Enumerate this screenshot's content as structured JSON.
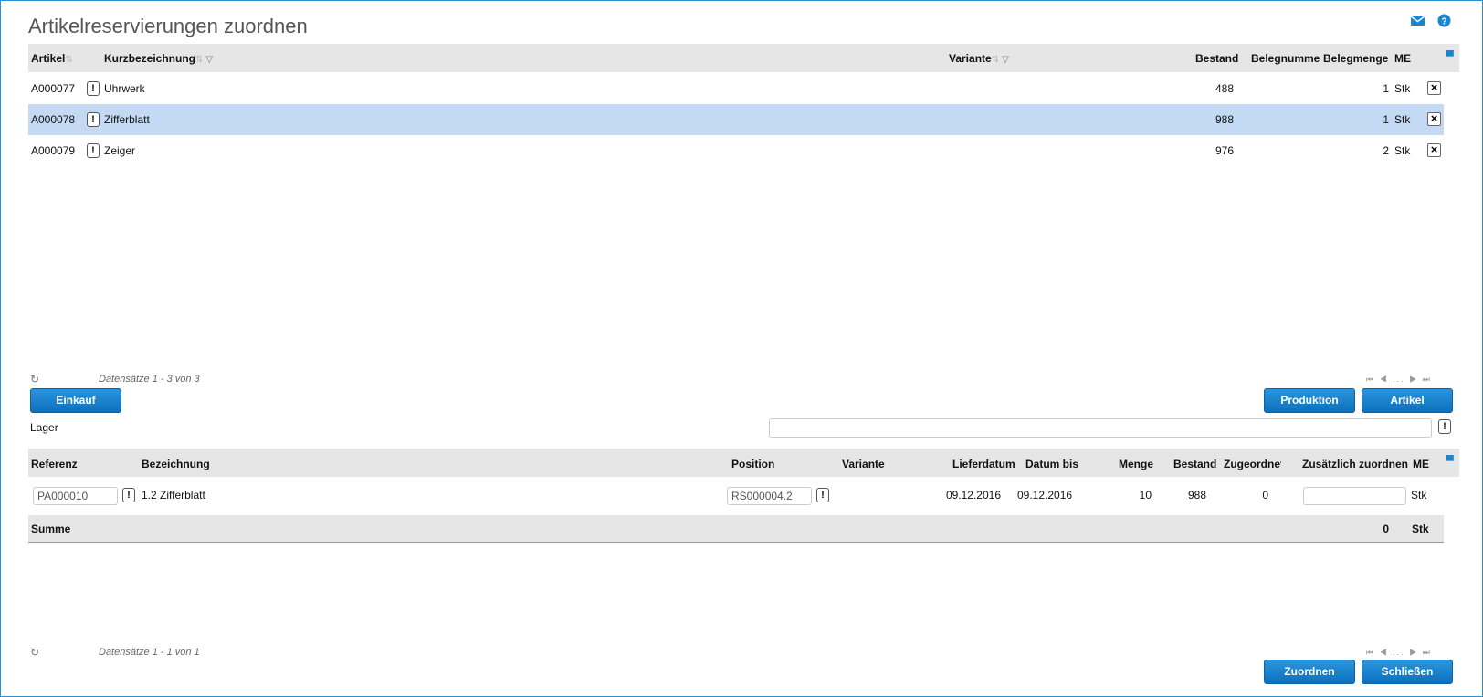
{
  "page": {
    "title": "Artikelreservierungen zuordnen"
  },
  "icons": {
    "mail": "mail-icon",
    "help": "help-icon"
  },
  "colors": {
    "accent": "#1a86d2",
    "button": "#0d70bd",
    "selected_row": "#c3d9f4",
    "header_bg": "#e6e6e6"
  },
  "articles_table": {
    "headers": {
      "artikel": "Artikel",
      "kurzbezeichnung": "Kurzbezeichnung",
      "variante": "Variante",
      "bestand": "Bestand",
      "belegnummer": "Belegnumme",
      "belegmenge": "Belegmenge",
      "me": "ME"
    },
    "rows": [
      {
        "artikel": "A000077",
        "kurzbezeichnung": "Uhrwerk",
        "variante": "",
        "bestand": "488",
        "belegnummer": "",
        "belegmenge": "1",
        "me": "Stk",
        "selected": false
      },
      {
        "artikel": "A000078",
        "kurzbezeichnung": "Zifferblatt",
        "variante": "",
        "bestand": "988",
        "belegnummer": "",
        "belegmenge": "1",
        "me": "Stk",
        "selected": true
      },
      {
        "artikel": "A000079",
        "kurzbezeichnung": "Zeiger",
        "variante": "",
        "bestand": "976",
        "belegnummer": "",
        "belegmenge": "2",
        "me": "Stk",
        "selected": false
      }
    ],
    "pager_info": "Datensätze 1 - 3 von 3",
    "pager_ellipsis": "..."
  },
  "buttons": {
    "einkauf": "Einkauf",
    "produktion": "Produktion",
    "artikel": "Artikel",
    "zuordnen": "Zuordnen",
    "schliessen": "Schließen"
  },
  "lager": {
    "label": "Lager",
    "value": ""
  },
  "assign_table": {
    "headers": {
      "referenz": "Referenz",
      "bezeichnung": "Bezeichnung",
      "position": "Position",
      "variante": "Variante",
      "lieferdatum": "Lieferdatum",
      "datum_bis": "Datum bis",
      "menge": "Menge",
      "bestand": "Bestand",
      "zugeordnet": "Zugeordnet",
      "zusaetzlich": "Zusätzlich zuordnen",
      "me": "ME"
    },
    "rows": [
      {
        "referenz": "PA000010",
        "bezeichnung": "1.2 Zifferblatt",
        "position": "RS000004.2",
        "variante": "",
        "lieferdatum": "09.12.2016",
        "datum_bis": "09.12.2016",
        "menge": "10",
        "bestand": "988",
        "zugeordnet": "0",
        "zusaetzlich": "",
        "me": "Stk"
      }
    ],
    "sum_label": "Summe",
    "sum_value": "0",
    "sum_me": "Stk",
    "pager_info": "Datensätze 1 - 1 von 1",
    "pager_ellipsis": "..."
  }
}
